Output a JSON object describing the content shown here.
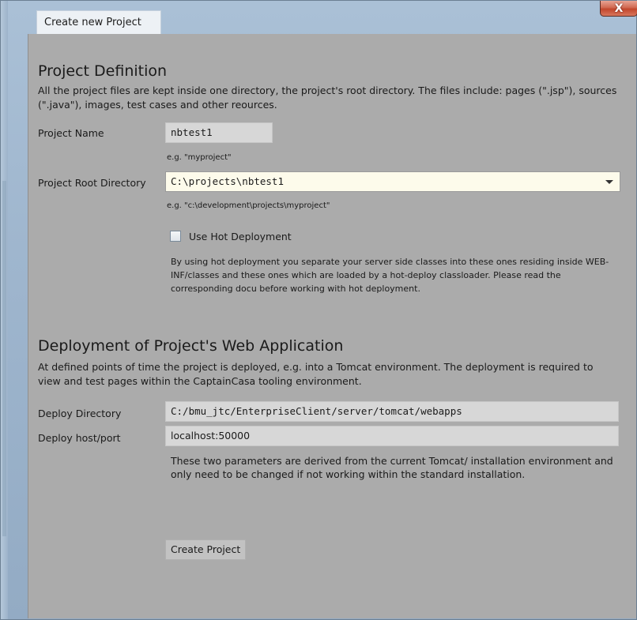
{
  "window": {
    "title": "Create new Project",
    "close_glyph": "X"
  },
  "definition": {
    "title": "Project Definition",
    "description": "All the project files are kept inside one directory, the project's root directory. The files include: pages (\".jsp\"), sources (\".java\"), images, test cases and other reources.",
    "name_label": "Project Name",
    "name_value": "nbtest1",
    "name_hint": "e.g. \"myproject\"",
    "root_label": "Project Root Directory",
    "root_value": "C:\\projects\\nbtest1",
    "root_hint": "e.g. \"c:\\development\\projects\\myproject\"",
    "hot_label": "Use Hot Deployment",
    "hot_checked": false,
    "hot_description": "By using hot deployment you separate your server side classes into these ones residing inside WEB-INF/classes and these ones which are loaded by a hot-deploy classloader. Please read the corresponding docu before working with hot deployment."
  },
  "deployment": {
    "title": "Deployment of Project's Web Application",
    "description": "At defined points of time the project is deployed, e.g. into a Tomcat environment. The deployment is required to view and test pages within the CaptainCasa tooling environment.",
    "dir_label": "Deploy Directory",
    "dir_value": "C:/bmu_jtc/EnterpriseClient/server/tomcat/webapps",
    "host_label": "Deploy host/port",
    "host_value": "localhost:50000",
    "note": "These two parameters are derived from the current Tomcat/ installation environment and only need to be changed if not working within the standard installation."
  },
  "actions": {
    "create_label": "Create Project"
  }
}
